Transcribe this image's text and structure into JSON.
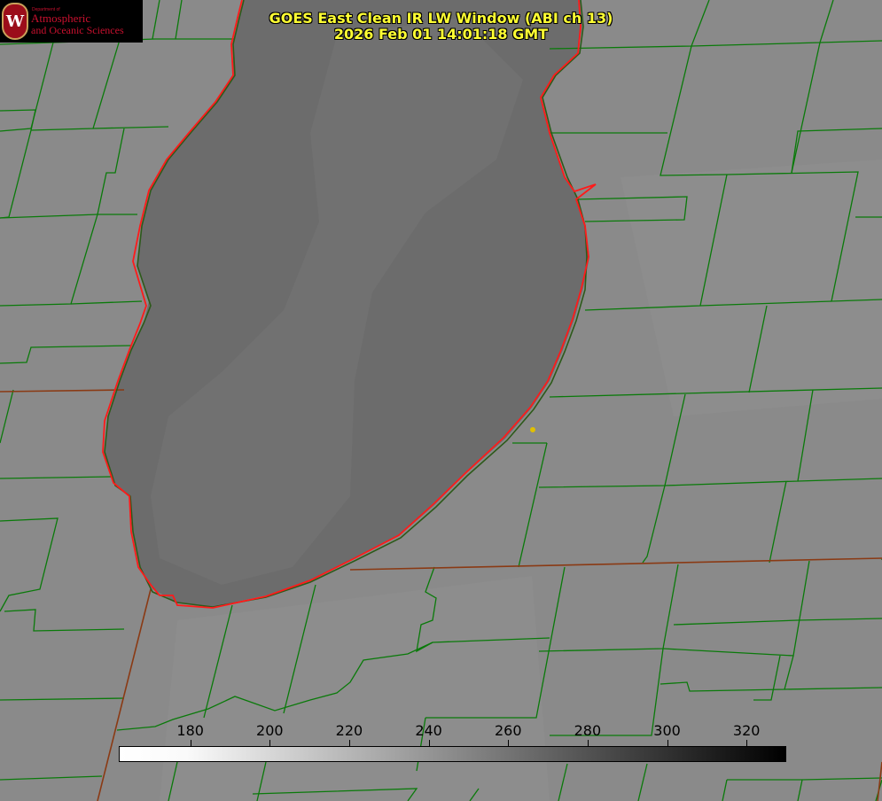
{
  "title": {
    "line1": "GOES East Clean IR LW Window (ABI ch 13)",
    "line2": "2026 Feb 01 14:01:18 GMT"
  },
  "logo": {
    "text_dept": "Department of",
    "text_line1": "Atmospheric",
    "text_line2": "and Oceanic Sciences",
    "seal_letter": "W"
  },
  "colorbar": {
    "ticks": [
      "180",
      "200",
      "220",
      "240",
      "260",
      "280",
      "300",
      "320"
    ],
    "tick_values": [
      180,
      200,
      220,
      240,
      260,
      280,
      300,
      320
    ],
    "range": [
      162,
      330
    ],
    "gradient": [
      "#ffffff",
      "#000000"
    ]
  },
  "colors": {
    "land": "#8a8a8a",
    "lake": "#6b6b6b",
    "county_lines": "#0a7a0a",
    "shoreline_hires": "#ff1a1a",
    "state_lines": "#8a3a14",
    "title": "#ffff33",
    "marker": "#e0c000"
  }
}
